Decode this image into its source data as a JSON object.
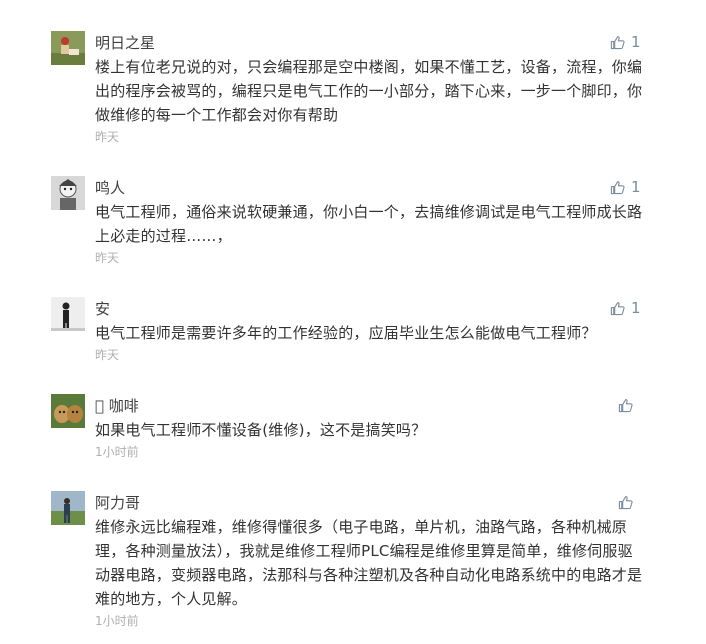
{
  "comments": [
    {
      "username": "明日之星",
      "text": "楼上有位老兄说的对，只会编程那是空中楼阁，如果不懂工艺，设备，流程，你编出的程序会被骂的，编程只是电气工作的一小部分，踏下心来，一步一个脚印，你做维修的每一个工作都会对你有帮助",
      "time": "昨天",
      "likes": "1",
      "avatar_icon": "person-outdoor-icon"
    },
    {
      "username": "鸣人",
      "text": "电气工程师，通俗来说软硬兼通，你小白一个，去搞维修调试是电气工程师成长路上必走的过程……，",
      "time": "昨天",
      "likes": "1",
      "avatar_icon": "anime-character-icon"
    },
    {
      "username": "安",
      "text": "电气工程师是需要许多年的工作经验的，应届毕业生怎么能做电气工程师？",
      "time": "昨天",
      "likes": "1",
      "avatar_icon": "silhouette-figure-icon"
    },
    {
      "username": "\u0000 咖啡",
      "text": "如果电气工程师不懂设备(维修)，这不是搞笑吗？",
      "time": "1小时前",
      "likes": "",
      "avatar_icon": "puppy-icon"
    },
    {
      "username": "阿力哥",
      "text": "维修永远比编程难，维修得懂很多（电子电路，单片机，油路气路，各种机械原理，各种测量放法），我就是维修工程师PLC编程是维修里算是简单，维修伺服驱动器电路，变频器电路，法那科与各种注塑机及各种自动化电路系统中的电路才是难的地方，个人见解。",
      "time": "1小时前",
      "likes": "",
      "avatar_icon": "person-standing-icon"
    }
  ],
  "colors": {
    "username": "#404040",
    "text": "#333333",
    "time": "#b0b0b0",
    "like_icon": "#7a8e9e"
  }
}
